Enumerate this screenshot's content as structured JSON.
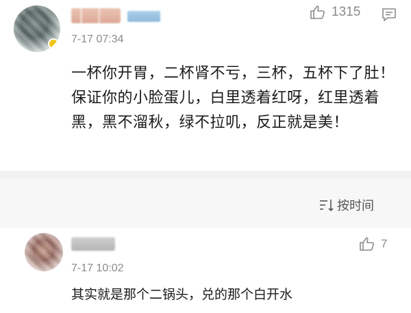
{
  "comments": [
    {
      "timestamp": "7-17 07:34",
      "like_count": "1315",
      "text": "一杯你开胃，二杯肾不亏，三杯，五杯下了肚！保证你的小脸蛋儿，白里透着红呀，红里透着黑，黑不溜秋，绿不拉叽，反正就是美！"
    },
    {
      "timestamp": "7-17 10:02",
      "like_count": "7",
      "text": "其实就是那个二锅头，兑的那个白开水"
    }
  ],
  "sort": {
    "label": "按时间",
    "icon": "sort-icon"
  },
  "colors": {
    "meta_gray": "#8a8a8a",
    "band": "#f1f1f1",
    "sort_bar": "#f7f7f7"
  }
}
